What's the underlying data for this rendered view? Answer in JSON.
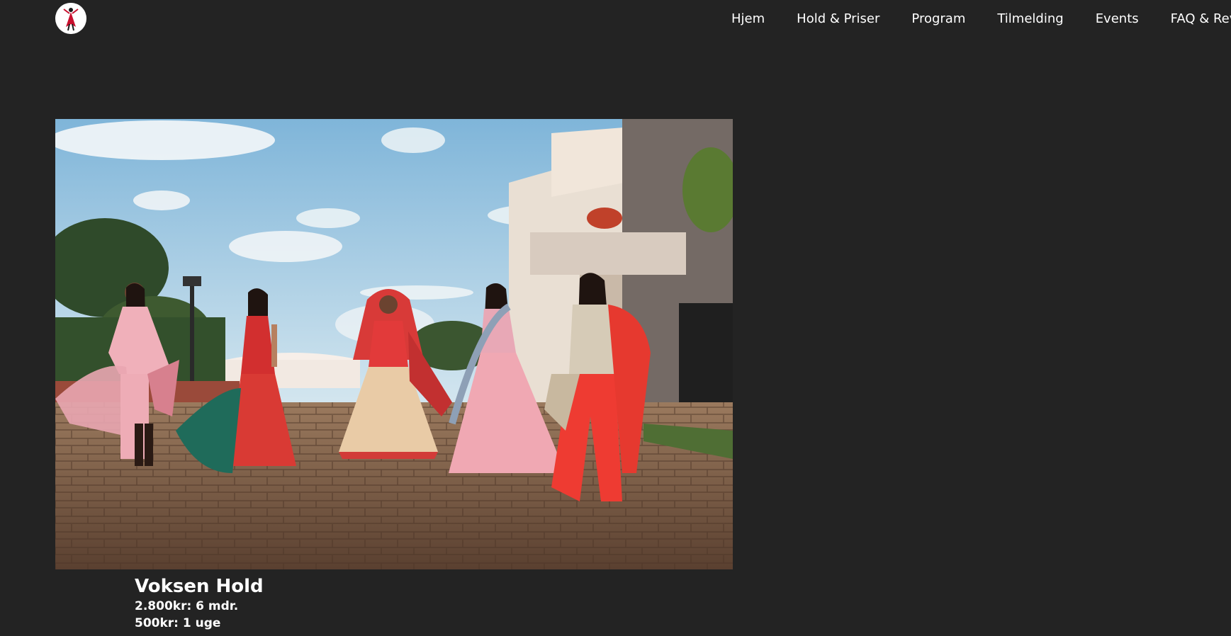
{
  "nav": {
    "items": [
      {
        "label": "Hjem"
      },
      {
        "label": "Hold & Priser"
      },
      {
        "label": "Program"
      },
      {
        "label": "Tilmelding"
      },
      {
        "label": "Events"
      },
      {
        "label": "FAQ & Reviews"
      }
    ]
  },
  "logo": {
    "icon": "dancer-logo-icon",
    "colors": {
      "figure": "#c8102e",
      "body": "#1a1a1a"
    }
  },
  "hero": {
    "image": "group-of-women-in-colorful-lehengas-dancing-on-patio-photo"
  },
  "offer": {
    "title": "Voksen Hold",
    "lines": [
      "2.800kr: 6 mdr.",
      "500kr: 1 uge"
    ]
  },
  "colors": {
    "background": "#232323",
    "text": "#ffffff"
  }
}
